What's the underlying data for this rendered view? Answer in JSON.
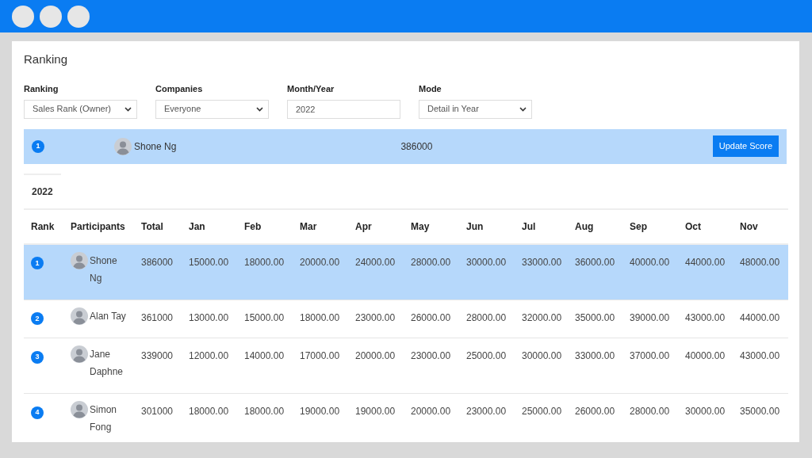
{
  "page_title": "Ranking",
  "filters": [
    {
      "label": "Ranking",
      "kind": "select",
      "value": "Sales Rank (Owner)"
    },
    {
      "label": "Companies",
      "kind": "select",
      "value": "Everyone"
    },
    {
      "label": "Month/Year",
      "kind": "input",
      "value": "2022"
    },
    {
      "label": "Mode",
      "kind": "select",
      "value": "Detail in Year"
    }
  ],
  "leader": {
    "rank": "1",
    "name": "Shone Ng",
    "score": "386000",
    "selected": true,
    "button": "Update Score"
  },
  "tabs": [
    {
      "label": "2022",
      "selected": true
    }
  ],
  "table": {
    "columns": [
      "Rank",
      "Participants",
      "Total",
      "Jan",
      "Feb",
      "Mar",
      "Apr",
      "May",
      "Jun",
      "Jul",
      "Aug",
      "Sep",
      "Oct",
      "Nov"
    ],
    "rows": [
      {
        "rank": "1",
        "name": "Shone Ng",
        "total": "386000",
        "months": [
          "15000.00",
          "18000.00",
          "20000.00",
          "24000.00",
          "28000.00",
          "30000.00",
          "33000.00",
          "36000.00",
          "40000.00",
          "44000.00",
          "48000.00"
        ],
        "selected": true
      },
      {
        "rank": "2",
        "name": "Alan Tay",
        "total": "361000",
        "months": [
          "13000.00",
          "15000.00",
          "18000.00",
          "23000.00",
          "26000.00",
          "28000.00",
          "32000.00",
          "35000.00",
          "39000.00",
          "43000.00",
          "44000.00"
        ],
        "selected": false
      },
      {
        "rank": "3",
        "name": "Jane Daphne",
        "total": "339000",
        "months": [
          "12000.00",
          "14000.00",
          "17000.00",
          "20000.00",
          "23000.00",
          "25000.00",
          "30000.00",
          "33000.00",
          "37000.00",
          "40000.00",
          "43000.00"
        ],
        "selected": false
      },
      {
        "rank": "4",
        "name": "Simon Fong",
        "total": "301000",
        "months": [
          "18000.00",
          "18000.00",
          "19000.00",
          "19000.00",
          "20000.00",
          "23000.00",
          "25000.00",
          "26000.00",
          "28000.00",
          "30000.00",
          "35000.00"
        ],
        "selected": false
      }
    ]
  }
}
